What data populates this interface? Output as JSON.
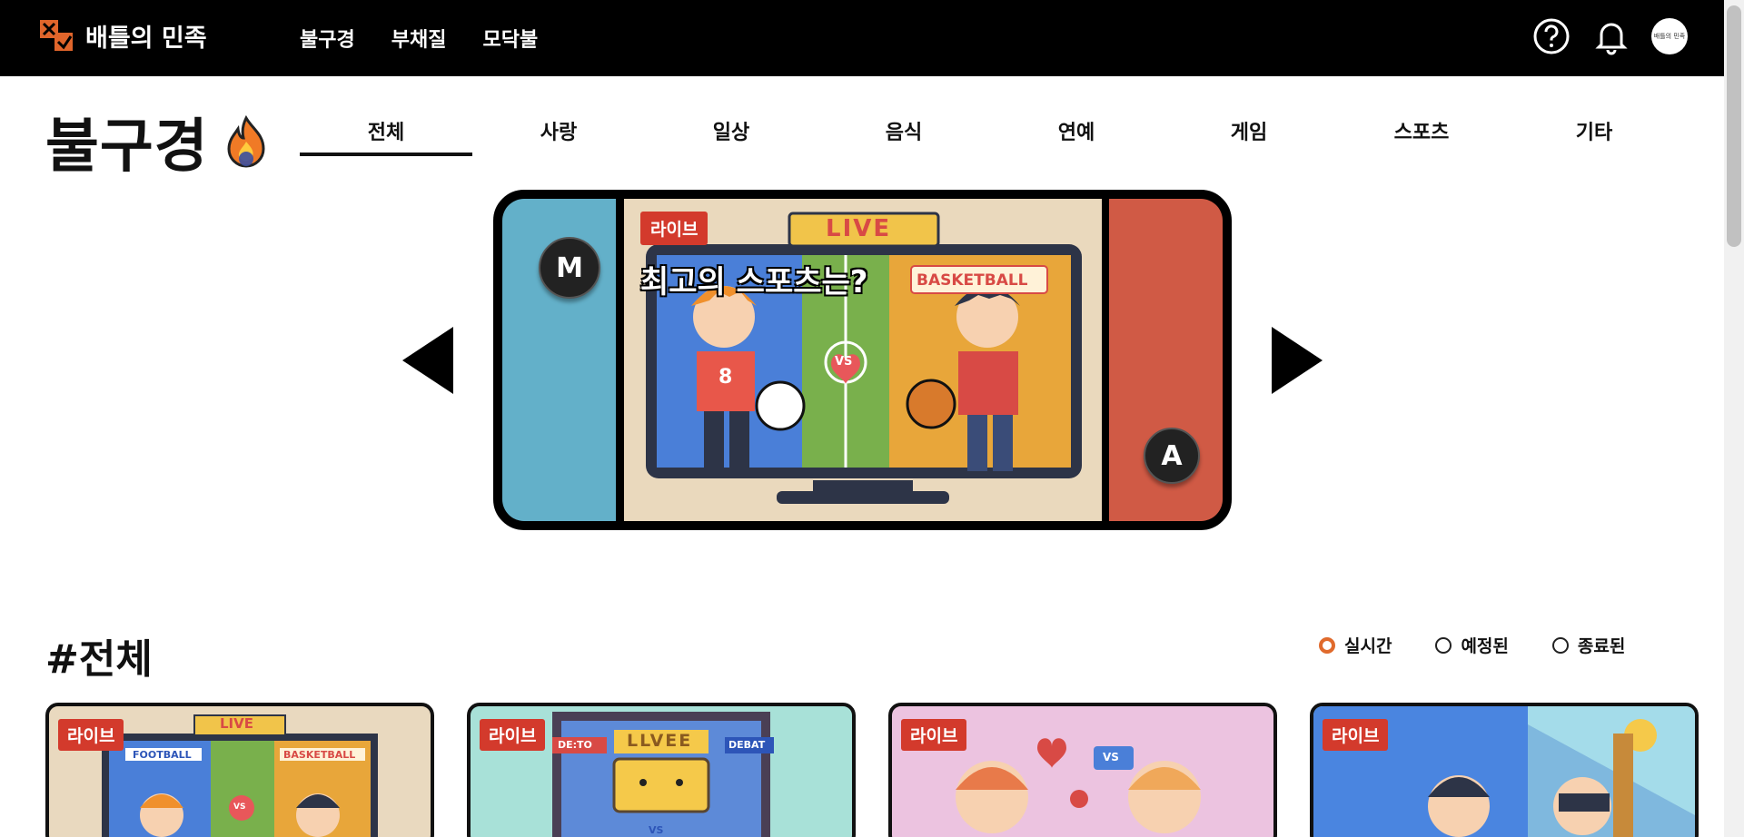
{
  "header": {
    "brand": "배틀의 민족",
    "nav": [
      "불구경",
      "부채질",
      "모닥불"
    ],
    "avatar_text": "배틀의 민족"
  },
  "page": {
    "title": "불구경",
    "categories": [
      "전체",
      "사랑",
      "일상",
      "음식",
      "연예",
      "게임",
      "스포츠",
      "기타"
    ],
    "active_category": "전체"
  },
  "carousel": {
    "left_button": "M",
    "right_button": "A",
    "badge": "라이브",
    "slide_title": "최고의 스포츠는?",
    "screen_label": "LIVE",
    "right_label": "BASKETBALL",
    "vs_label": "VS",
    "jersey_number": "8"
  },
  "section": {
    "title": "#전체",
    "filters": [
      {
        "label": "실시간",
        "checked": true
      },
      {
        "label": "예정된",
        "checked": false
      },
      {
        "label": "종료된",
        "checked": false
      }
    ]
  },
  "cards": [
    {
      "badge": "라이브",
      "labels": [
        "LIVE",
        "FOOTBALL",
        "BASKETBALL",
        "VS"
      ],
      "bg": "#e9d9bf"
    },
    {
      "badge": "라이브",
      "labels": [
        "LLVEE",
        "DE:TO",
        "DEBAT",
        "VS"
      ],
      "bg": "#a8e1d8"
    },
    {
      "badge": "라이브",
      "labels": [
        "VS"
      ],
      "bg": "#ecc3e0"
    },
    {
      "badge": "라이브",
      "labels": [],
      "bg": "#9fd7e6"
    }
  ],
  "colors": {
    "accent_red": "#d33a2c",
    "radio_orange": "#e06a2c",
    "panel_blue": "#63b0c9",
    "panel_red": "#d05a45"
  }
}
